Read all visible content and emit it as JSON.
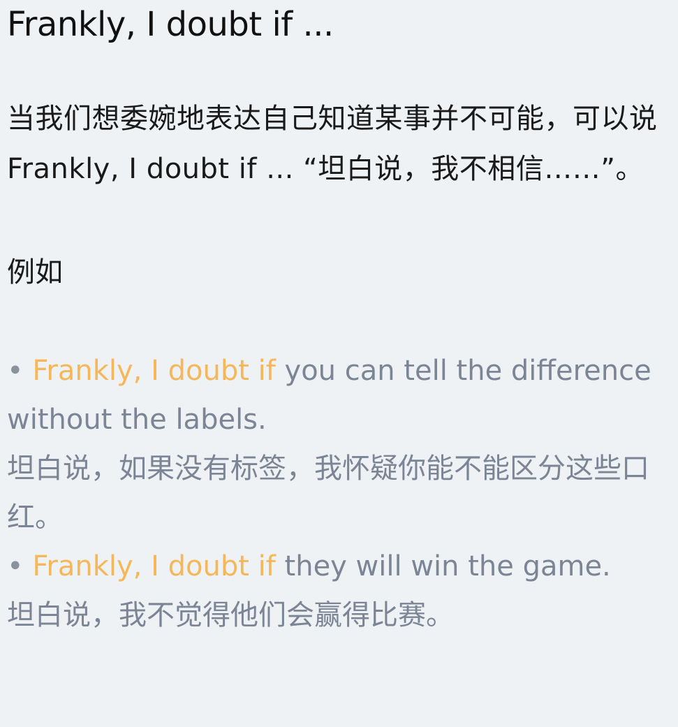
{
  "title": "Frankly, I doubt if ...",
  "intro": "当我们想委婉地表达自己知道某事并不可能，可以说 Frankly, I doubt if ... “坦白说，我不相信……”。",
  "example_label": "例如",
  "bullet": "•",
  "examples": [
    {
      "highlight": "Frankly, I doubt if",
      "rest": " you can tell the difference without the labels.",
      "translation": "坦白说，如果没有标签，我怀疑你能不能区分这些口红。"
    },
    {
      "highlight": "Frankly, I doubt if",
      "rest": " they will win the game.",
      "translation": "坦白说，我不觉得他们会赢得比赛。"
    }
  ],
  "colors": {
    "background": "#eff2f4",
    "highlight": "#f5b759",
    "example_text": "#7b8595",
    "body_text": "#1a1a1a"
  }
}
